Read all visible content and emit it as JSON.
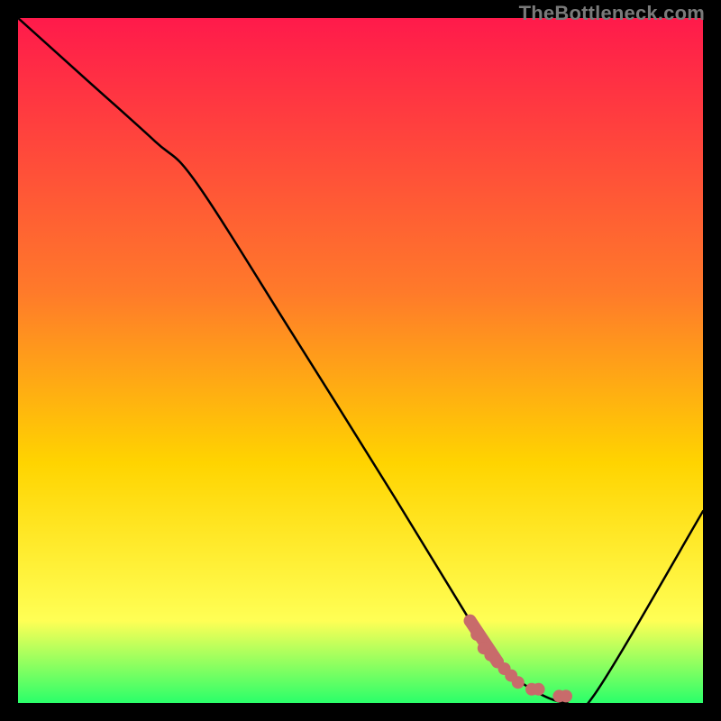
{
  "watermark": "TheBottleneck.com",
  "chart_data": {
    "type": "line",
    "title": "",
    "xlabel": "",
    "ylabel": "",
    "xlim": [
      0,
      100
    ],
    "ylim": [
      0,
      100
    ],
    "grid": false,
    "legend": false,
    "series": [
      {
        "name": "bottleneck-curve",
        "x": [
          0,
          10,
          20,
          26,
          40,
          55,
          66,
          70,
          75,
          80,
          84,
          100
        ],
        "y": [
          100,
          91,
          82,
          76,
          54,
          30,
          12,
          6,
          2,
          0,
          1,
          28
        ]
      }
    ],
    "marker_cluster": {
      "name": "highlight-region",
      "color": "#c86b6b",
      "x": [
        66,
        67,
        68,
        69,
        70,
        71,
        72,
        73,
        75,
        76,
        79,
        80
      ],
      "y": [
        12,
        10,
        8,
        7,
        6,
        5,
        4,
        3,
        2,
        2,
        1,
        1
      ]
    },
    "background_gradient": {
      "top": "#ff1a4b",
      "mid1": "#ff7a2a",
      "mid2": "#ffd400",
      "mid3": "#ffff55",
      "bottom": "#2aff6a"
    }
  }
}
